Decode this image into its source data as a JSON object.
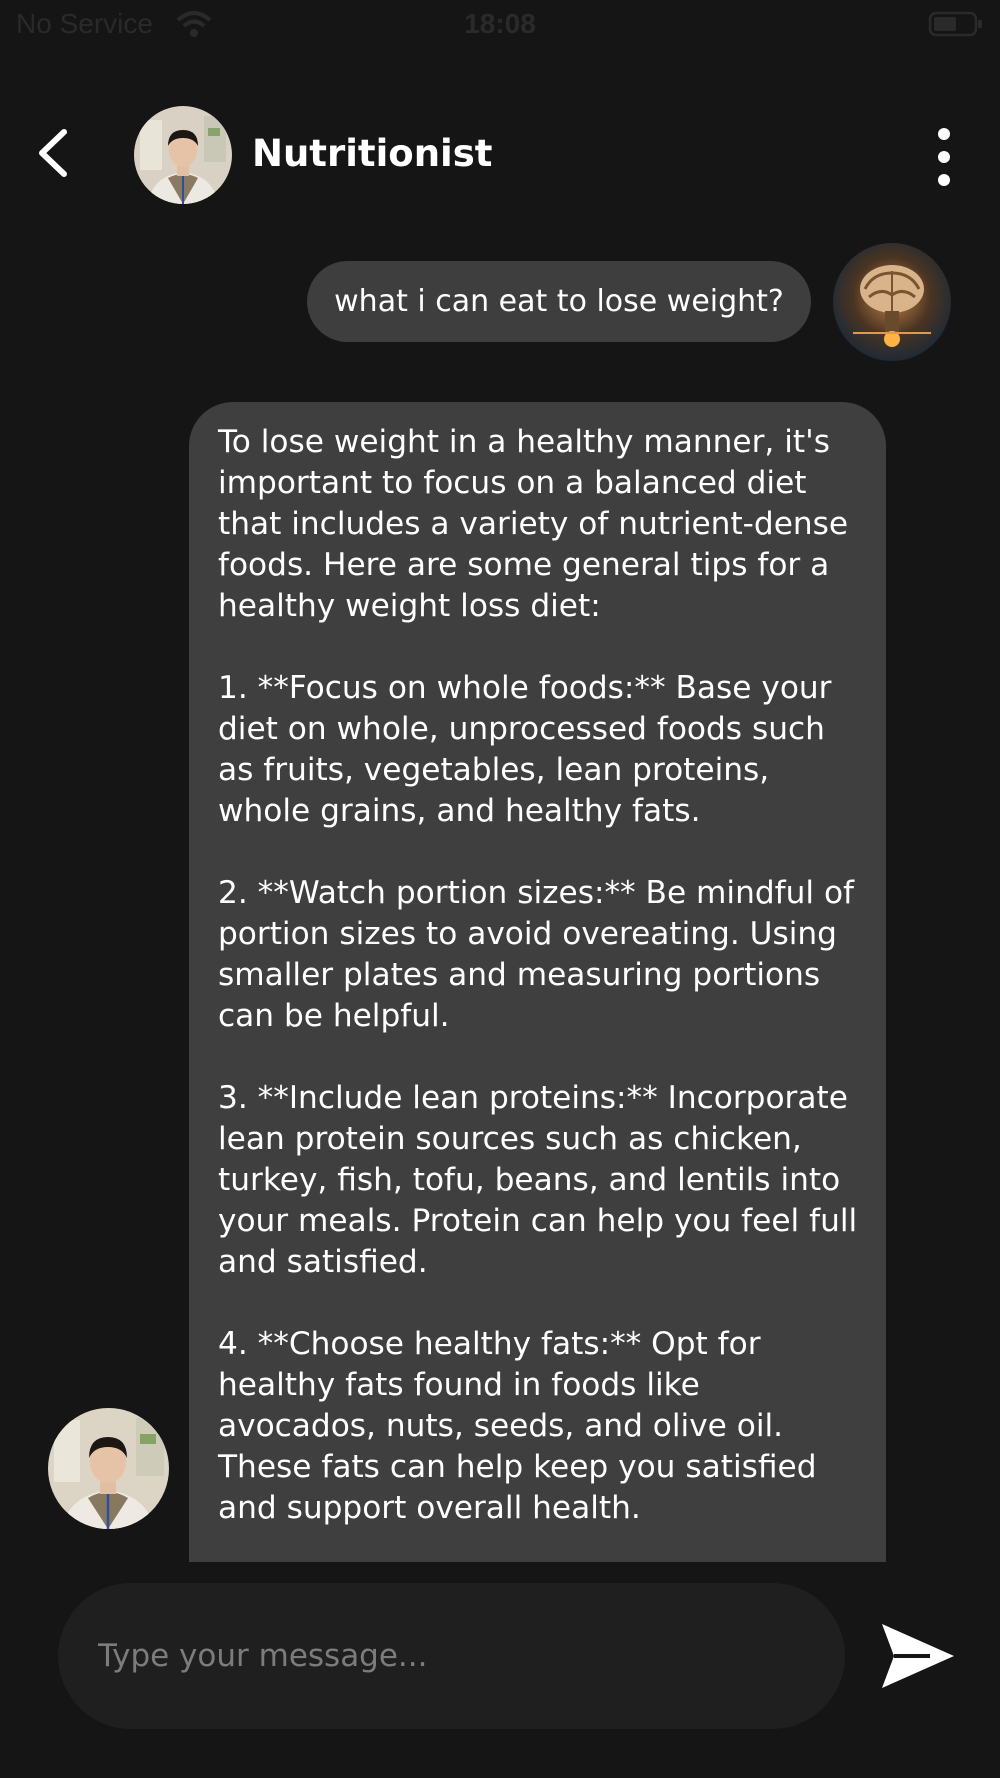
{
  "status_bar": {
    "carrier": "No Service",
    "time": "18:08"
  },
  "header": {
    "title": "Nutritionist",
    "back_icon": "chevron-left-icon",
    "more_icon": "vertical-ellipsis-icon"
  },
  "messages": [
    {
      "role": "user",
      "text": "what i can eat to lose weight?"
    },
    {
      "role": "assistant",
      "text": "To lose weight in a healthy manner, it's important to focus on a balanced diet that includes a variety of nutrient-dense foods. Here are some general tips for a healthy weight loss diet:\n\n1. **Focus on whole foods:** Base your diet on whole, unprocessed foods such as fruits, vegetables, lean proteins, whole grains, and healthy fats.\n\n2. **Watch portion sizes:** Be mindful of portion sizes to avoid overeating. Using smaller plates and measuring portions can be helpful.\n\n3. **Include lean proteins:** Incorporate lean protein sources such as chicken, turkey, fish, tofu, beans, and lentils into your meals. Protein can help you feel full and satisfied.\n\n4. **Choose healthy fats:** Opt for healthy fats found in foods like avocados, nuts, seeds, and olive oil. These fats can help keep you satisfied and support overall health."
    }
  ],
  "composer": {
    "placeholder": "Type your message...",
    "send_icon": "send-icon"
  },
  "colors": {
    "background": "#151515",
    "bubble": "#3e3e3e",
    "input": "#1f1f1f",
    "placeholder": "#7c7c7c"
  }
}
